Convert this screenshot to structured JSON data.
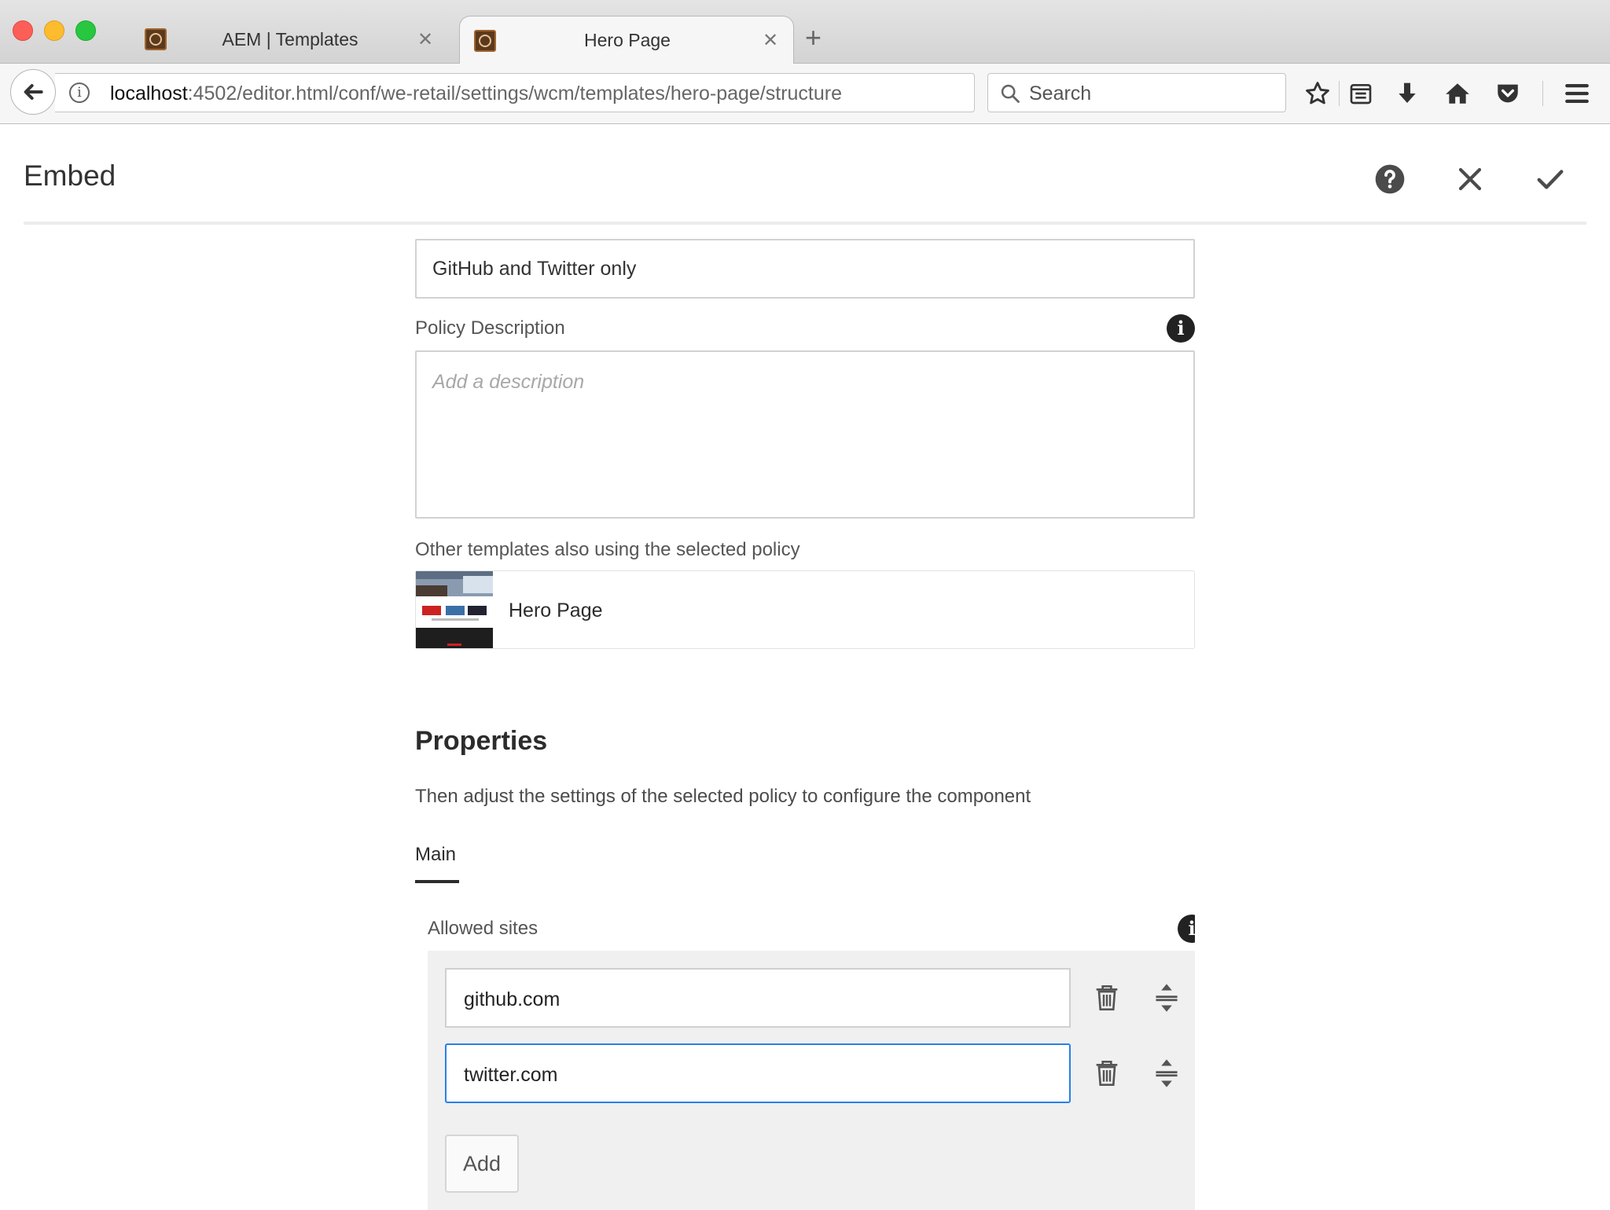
{
  "browser": {
    "tabs": [
      {
        "title": "AEM | Templates",
        "active": false
      },
      {
        "title": "Hero Page",
        "active": true
      }
    ],
    "url": {
      "host": "localhost",
      "path": ":4502/editor.html/conf/we-retail/settings/wcm/templates/hero-page/structure"
    },
    "search_placeholder": "Search",
    "icons": [
      "back-icon",
      "info-icon",
      "reload-icon",
      "search-icon",
      "bookmark-star-icon",
      "reading-list-icon",
      "download-icon",
      "home-icon",
      "pocket-icon",
      "menu-icon"
    ]
  },
  "dialog": {
    "title": "Embed",
    "policy_title_value": "GitHub and Twitter only",
    "policy_description_label": "Policy Description",
    "policy_description_placeholder": "Add a description",
    "other_templates_label": "Other templates also using the selected policy",
    "template_card_title": "Hero Page",
    "properties_heading": "Properties",
    "properties_description": "Then adjust the settings of the selected policy to configure the component",
    "tab_main": "Main",
    "allowed_sites_label": "Allowed sites",
    "allowed_sites": [
      "github.com",
      "twitter.com"
    ],
    "add_label": "Add"
  },
  "colors": {
    "focus_border": "#2680eb",
    "multifield_bg": "#f0f0f0"
  }
}
